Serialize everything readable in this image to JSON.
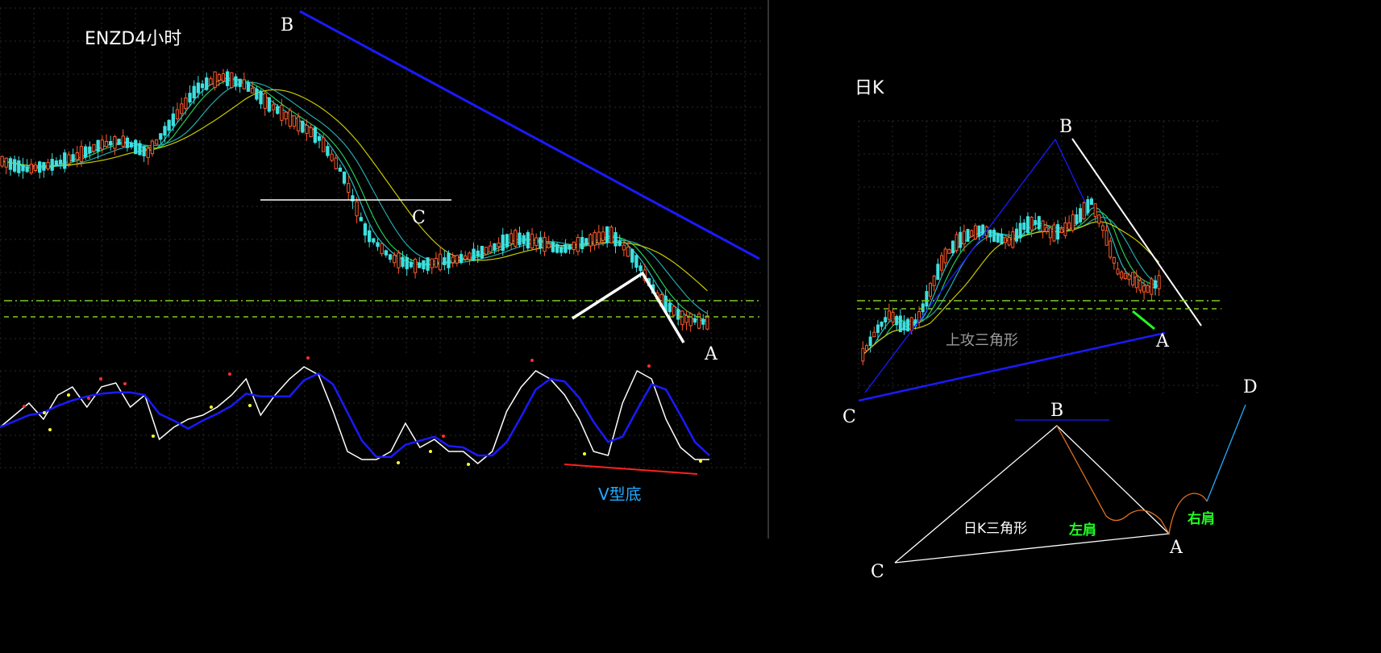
{
  "left_panel": {
    "title": "ENZD4小时",
    "point_b": "B",
    "point_c": "C",
    "point_a": "A",
    "oscillator_note": "V型底"
  },
  "right_panel": {
    "title": "日K",
    "point_b": "B",
    "point_c": "C",
    "point_a": "A",
    "triangle_note": "上攻三角形"
  },
  "sketch": {
    "point_b": "B",
    "point_c": "C",
    "point_a": "A",
    "point_d": "D",
    "triangle_label": "日K三角形",
    "left_shoulder": "左肩",
    "right_shoulder": "右肩"
  },
  "colors": {
    "background": "#000000",
    "candle_up": "#ff5a2a",
    "candle_down": "#3ee0e0",
    "trendline": "#1a1aff",
    "ma_yellow": "#c8c800",
    "ma_green": "#22cc55",
    "ma_cyan": "#22c0c0",
    "support_dash": "#7ccc22",
    "annotation_blue": "#22aaff",
    "annotation_green": "#22ff22",
    "shoulder_orange": "#e07020"
  }
}
